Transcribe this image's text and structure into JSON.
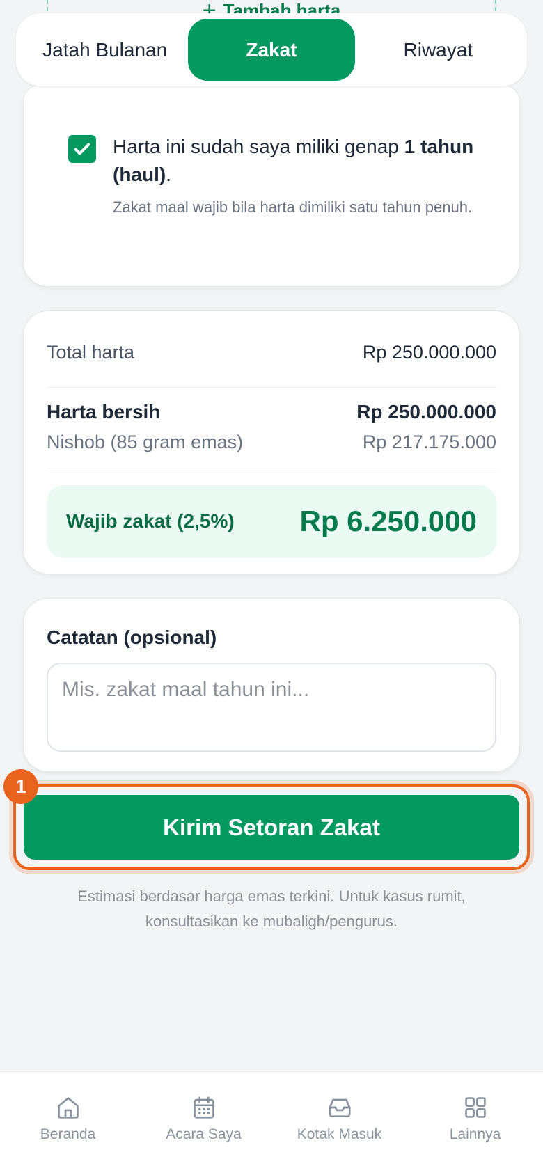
{
  "add_asset": {
    "label": "Tambah harta",
    "icon": "plus-icon"
  },
  "tabs": [
    {
      "label": "Jatah Bulanan",
      "active": false
    },
    {
      "label": "Zakat",
      "active": true
    },
    {
      "label": "Riwayat",
      "active": false
    }
  ],
  "haul": {
    "checked": true,
    "text_prefix": "Harta ini sudah saya miliki genap ",
    "text_bold": "1 tahun (haul)",
    "text_suffix": ".",
    "subtext": "Zakat maal wajib bila harta dimiliki satu tahun penuh."
  },
  "summary": {
    "total_label": "Total harta",
    "total_value": "Rp 250.000.000",
    "bersih_label": "Harta bersih",
    "bersih_value": "Rp 250.000.000",
    "nishob_label": "Nishob (85 gram emas)",
    "nishob_value": "Rp 217.175.000",
    "wajib_label": "Wajib zakat (2,5%)",
    "wajib_value": "Rp 6.250.000"
  },
  "catatan": {
    "label": "Catatan (opsional)",
    "placeholder": "Mis. zakat maal tahun ini...",
    "value": ""
  },
  "submit": {
    "label": "Kirim Setoran Zakat",
    "badge": "1"
  },
  "note": "Estimasi berdasar harga emas terkini. Untuk kasus rumit, konsultasikan ke mubaligh/pengurus.",
  "nav": [
    {
      "label": "Beranda",
      "icon": "home-icon"
    },
    {
      "label": "Acara Saya",
      "icon": "calendar-icon"
    },
    {
      "label": "Kotak Masuk",
      "icon": "inbox-icon"
    },
    {
      "label": "Lainnya",
      "icon": "grid-icon"
    }
  ],
  "colors": {
    "primary": "#059962",
    "highlight": "#e8641e",
    "wajib_bg": "#ebfbf3"
  }
}
